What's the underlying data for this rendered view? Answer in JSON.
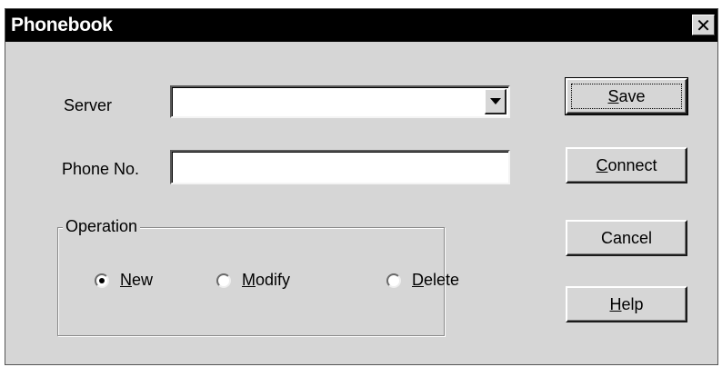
{
  "window": {
    "title": "Phonebook",
    "close_glyph": "✕"
  },
  "form": {
    "server_label": "Server",
    "server_value": "",
    "phone_label": "Phone No.",
    "phone_value": ""
  },
  "operation": {
    "legend": "Operation",
    "options": [
      {
        "mnemonic": "N",
        "rest": "ew",
        "checked": true
      },
      {
        "mnemonic": "M",
        "rest": "odify",
        "checked": false
      },
      {
        "mnemonic": "D",
        "rest": "elete",
        "checked": false
      }
    ]
  },
  "buttons": {
    "save": {
      "mnemonic": "S",
      "rest": "ave"
    },
    "connect": {
      "mnemonic": "C",
      "rest": "onnect"
    },
    "cancel": {
      "label": "Cancel"
    },
    "help": {
      "mnemonic": "H",
      "rest": "elp"
    }
  },
  "icons": {
    "combo_arrow": "chevron-down-icon",
    "close": "close-icon"
  }
}
